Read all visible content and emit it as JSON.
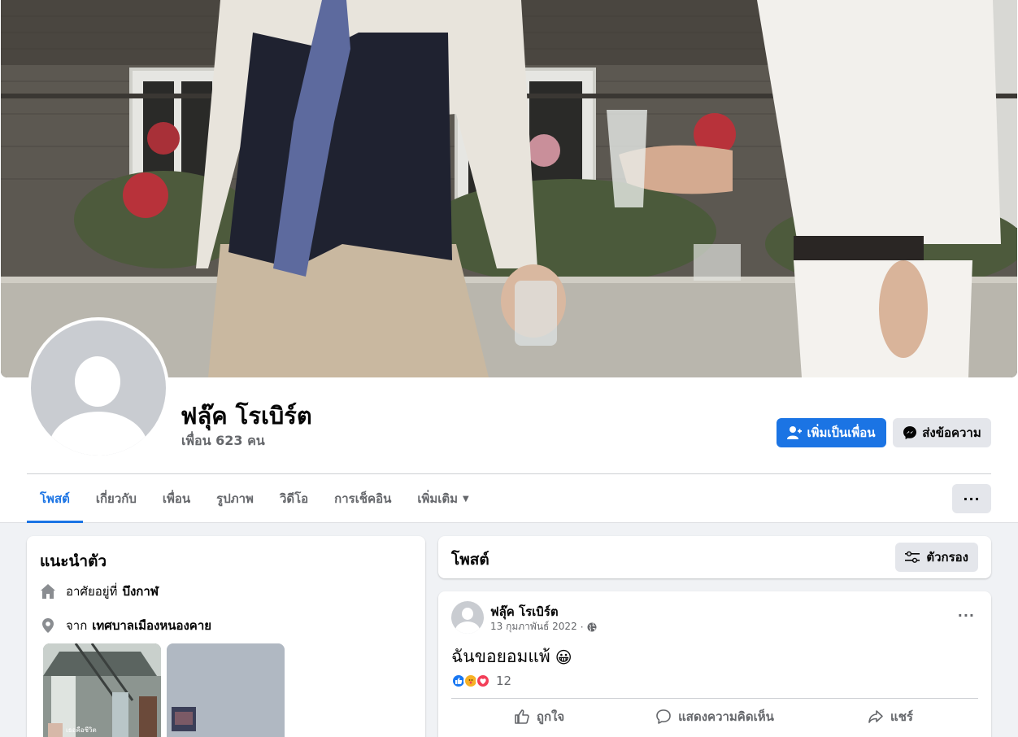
{
  "profile": {
    "name": "ฟลุ๊ค โรเบิร์ต",
    "friends_text": "เพื่อน 623 คน"
  },
  "actions": {
    "add_friend_label": "เพิ่มเป็นเพื่อน",
    "message_label": "ส่งข้อความ",
    "more_label": "···"
  },
  "tabs": [
    {
      "label": "โพสต์",
      "active": true
    },
    {
      "label": "เกี่ยวกับ",
      "active": false
    },
    {
      "label": "เพื่อน",
      "active": false
    },
    {
      "label": "รูปภาพ",
      "active": false
    },
    {
      "label": "วิดีโอ",
      "active": false
    },
    {
      "label": "การเช็คอิน",
      "active": false
    },
    {
      "label": "เพิ่มเติม",
      "active": false
    }
  ],
  "intro": {
    "title": "แนะนำตัว",
    "lives_prefix": "อาศัยอยู่ที่",
    "lives_place": "บึงกาฬ",
    "from_prefix": "จาก",
    "from_place": "เทศบาลเมืองหนองคาย",
    "photo_tiles": [
      {
        "icon": "photo-thumbnail",
        "caption": "เธอคือชีวิต"
      },
      {
        "icon": "photo-thumbnail",
        "caption": ""
      }
    ]
  },
  "posts_header": {
    "title": "โพสต์",
    "filter_label": "ตัวกรอง"
  },
  "post": {
    "author": "ฟลุ๊ค โรเบิร์ต",
    "date": "13 กุมภาพันธ์ 2022",
    "separator": "·",
    "privacy_icon": "globe-icon",
    "text": "ฉันขอยอมแพ้",
    "emoji": "😀",
    "reactions": [
      "like",
      "care",
      "love"
    ],
    "reaction_count": "12",
    "like_label": "ถูกใจ",
    "comment_label": "แสดงความคิดเห็น",
    "share_label": "แชร์",
    "menu_label": "···"
  },
  "colors": {
    "accent": "#1b74e4",
    "background": "#f0f2f5",
    "secondary_text": "#65676b",
    "like_blue": "#1877f2",
    "love_red": "#f33e58",
    "care_yellow": "#f7b125"
  }
}
